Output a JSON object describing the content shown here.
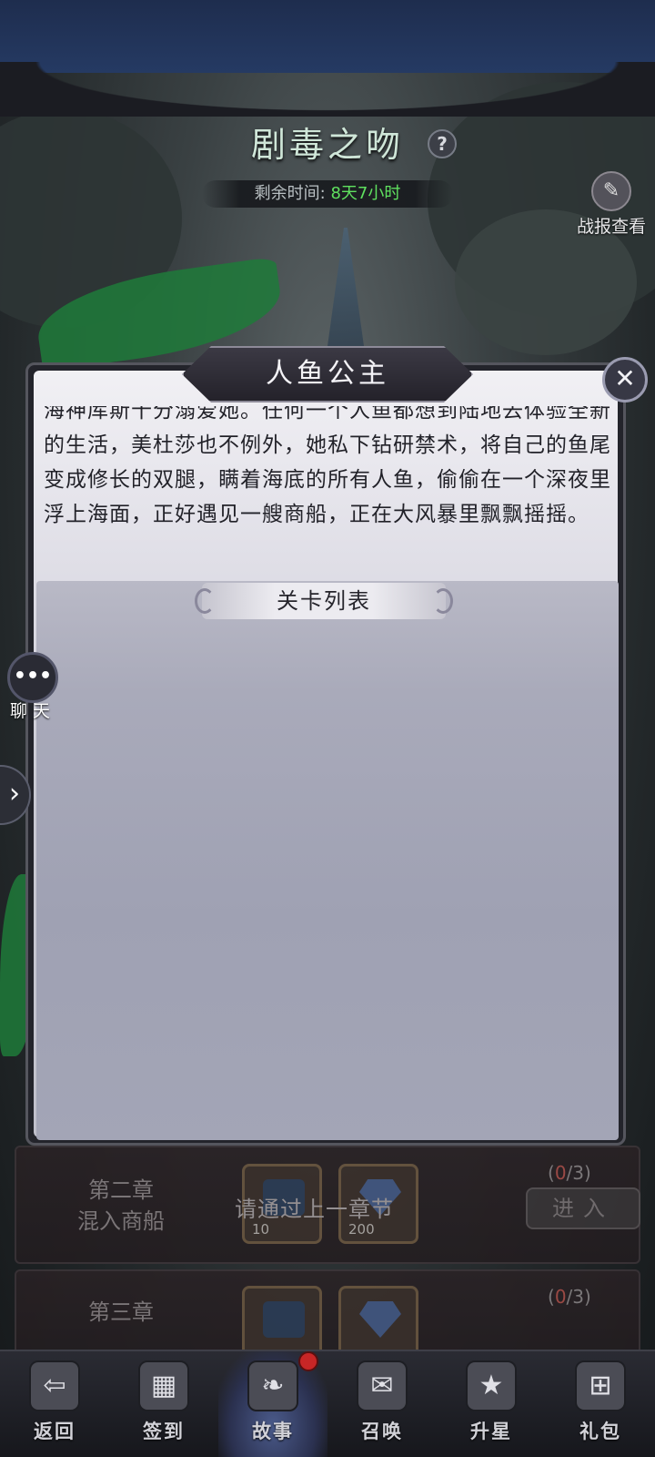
{
  "event": {
    "title": "剧毒之吻",
    "help_symbol": "?",
    "timer_label": "剩余时间:",
    "timer_value": "8天7小时",
    "report_label": "战报查看"
  },
  "modal": {
    "title": "人鱼公主",
    "close_symbol": "✕",
    "story_text": "海神库斯十分溺爱她。任何一个人鱼都想到陆地去体验全新的生活，美杜莎也不例外，她私下钻研禁术，将自己的鱼尾变成修长的双腿，瞒着海底的所有人鱼，偷偷在一个深夜里浮上海面，正好遇见一艘商船，正在大风暴里飘飘摇摇。",
    "level_list_title": "关卡列表"
  },
  "side": {
    "chat_label": "聊天",
    "chat_icon": "speech-bubble-icon",
    "expand_symbol": "›"
  },
  "chapters": [
    {
      "title_line1": "第二章",
      "title_line2": "混入商船",
      "locked_message": "请通过上一章节",
      "progress_current": "0",
      "progress_total": "/3",
      "progress_open": "(",
      "progress_close": ")",
      "enter_label": "进入",
      "rewards": [
        {
          "icon": "scroll-icon",
          "count": "10"
        },
        {
          "icon": "diamond-icon",
          "count": "200"
        }
      ]
    },
    {
      "title_line1": "第三章",
      "progress_current": "0",
      "progress_total": "/3",
      "progress_open": "(",
      "progress_close": ")",
      "rewards": [
        {
          "icon": "scroll-icon"
        },
        {
          "icon": "diamond-icon"
        }
      ]
    }
  ],
  "nav": [
    {
      "label": "返回",
      "icon": "back-icon",
      "active": false
    },
    {
      "label": "签到",
      "icon": "calendar-icon",
      "active": false
    },
    {
      "label": "故事",
      "icon": "book-icon",
      "active": true,
      "badge": true
    },
    {
      "label": "召唤",
      "icon": "scroll-icon",
      "active": false
    },
    {
      "label": "升星",
      "icon": "star-badge-icon",
      "active": false
    },
    {
      "label": "礼包",
      "icon": "gift-icon",
      "active": false
    }
  ],
  "colors": {
    "timer_value": "#5fe05f",
    "badge": "#c72626",
    "progress_current": "#b0504a"
  }
}
